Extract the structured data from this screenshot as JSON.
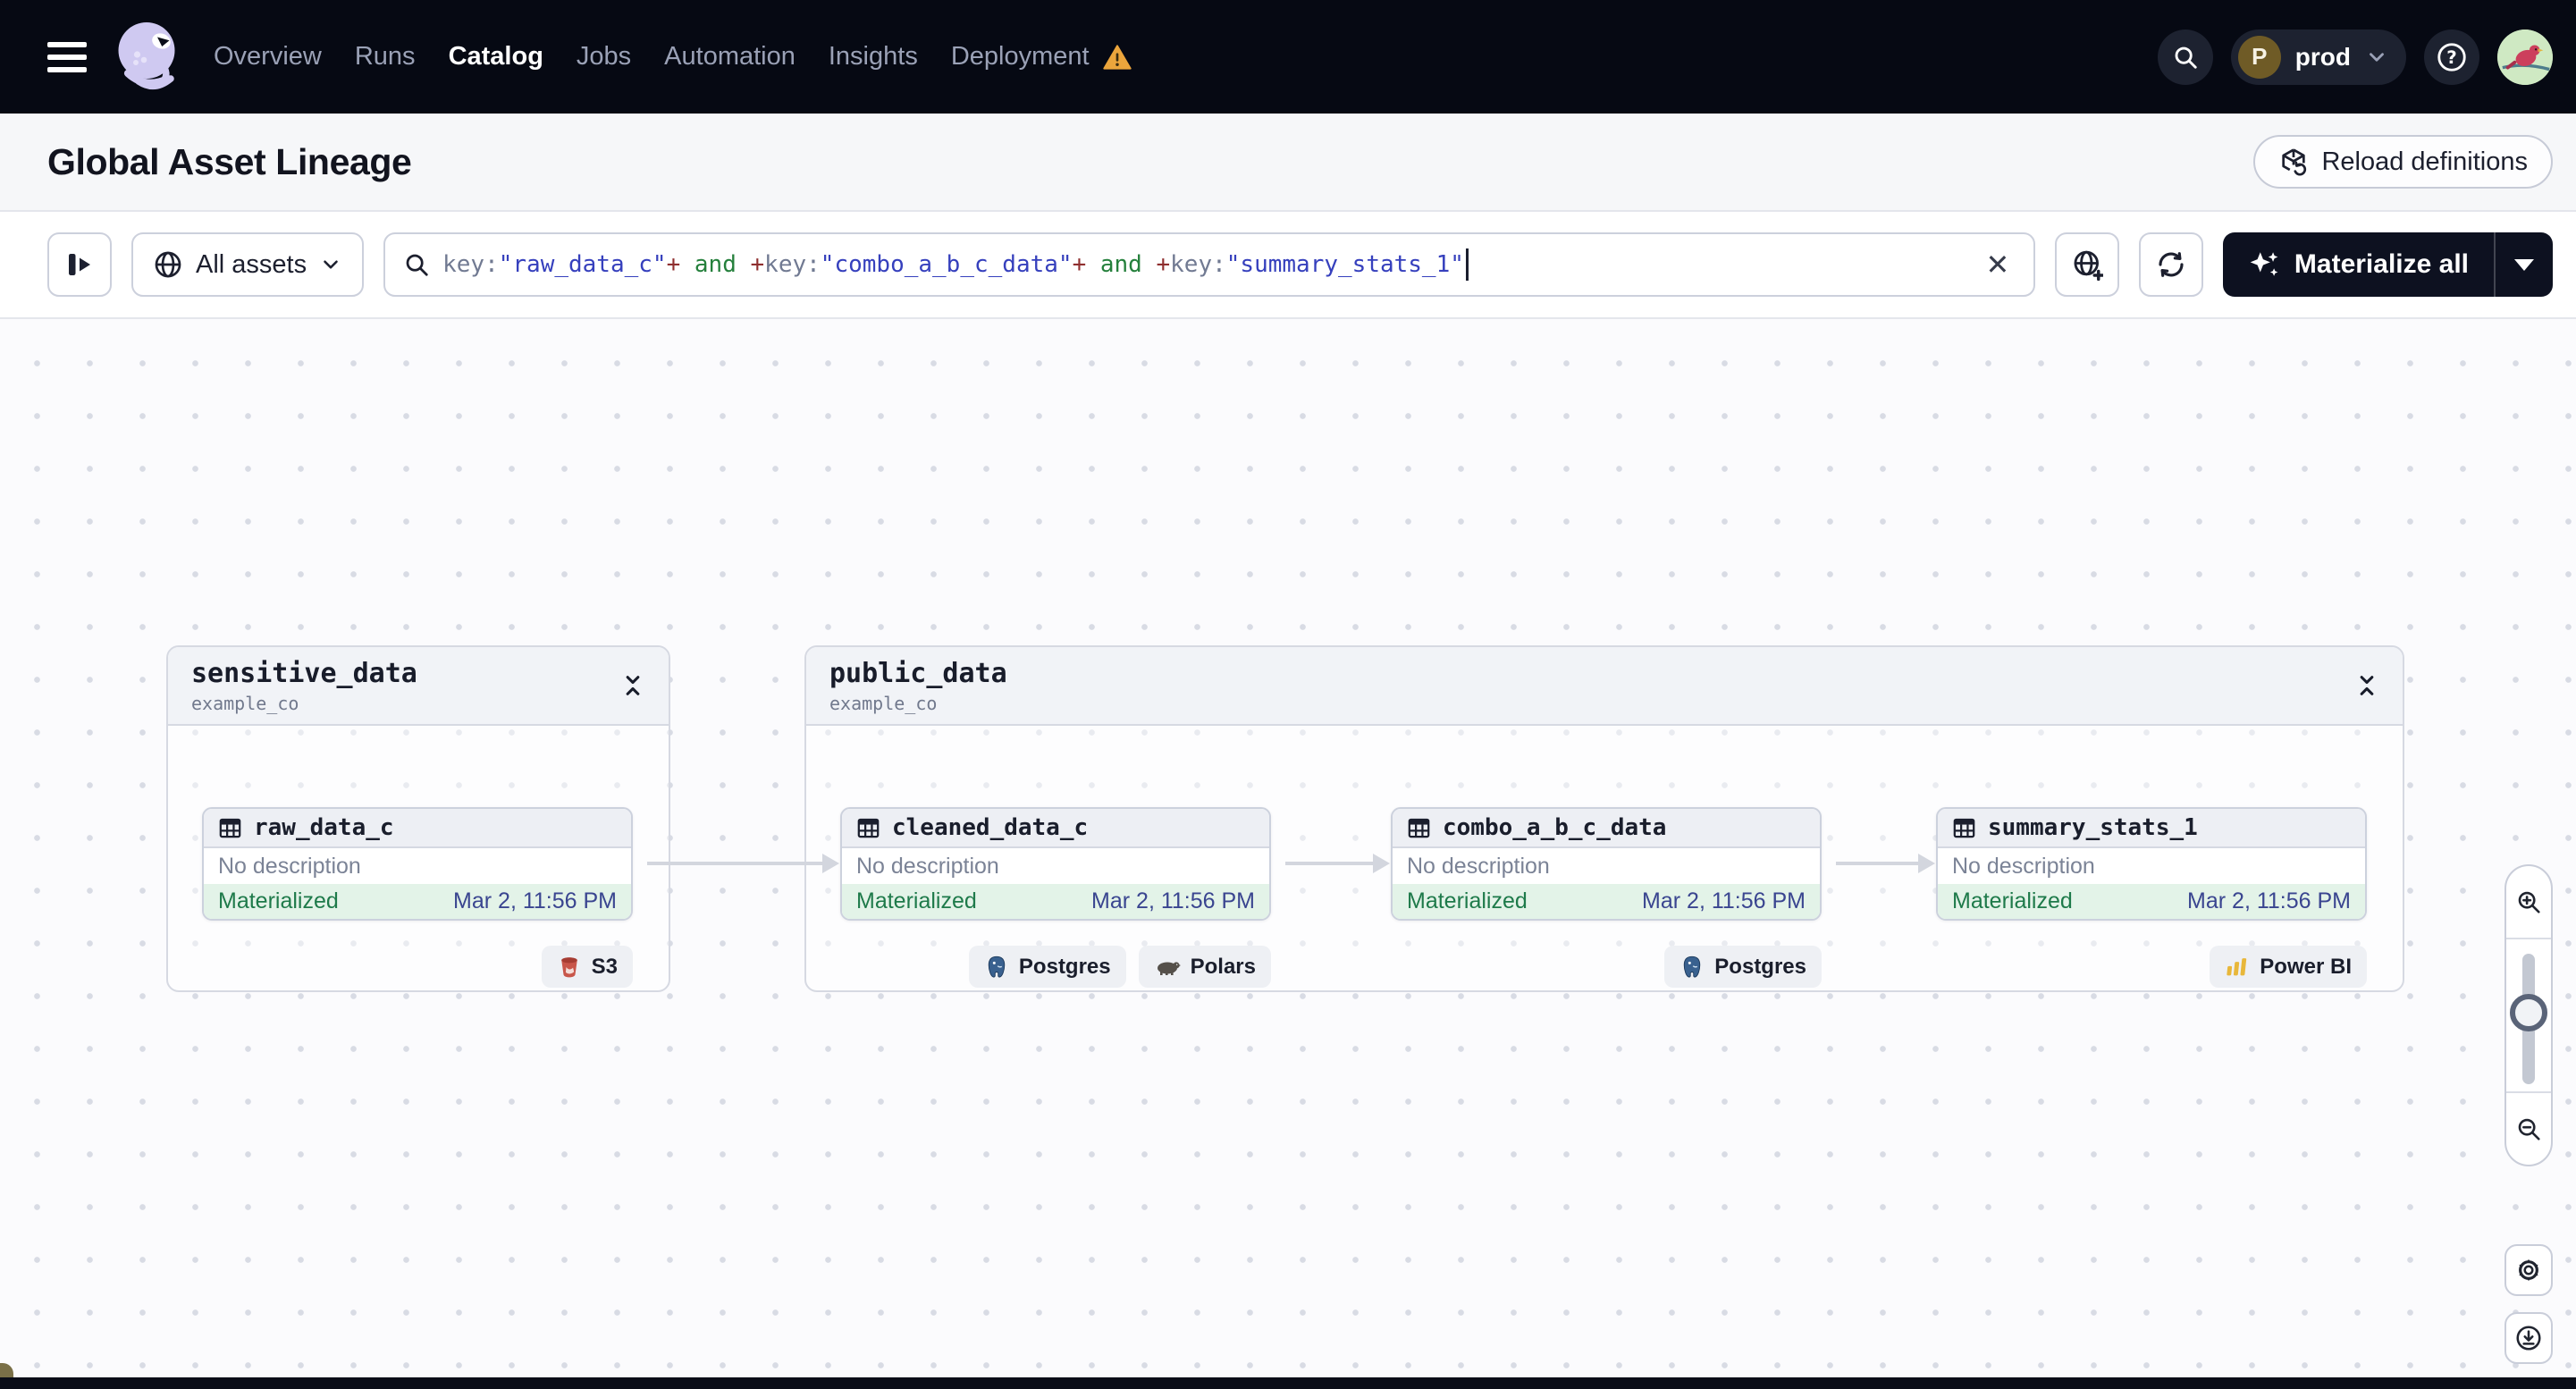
{
  "navbar": {
    "items": [
      {
        "label": "Overview",
        "active": false,
        "warning": false
      },
      {
        "label": "Runs",
        "active": false,
        "warning": false
      },
      {
        "label": "Catalog",
        "active": true,
        "warning": false
      },
      {
        "label": "Jobs",
        "active": false,
        "warning": false
      },
      {
        "label": "Automation",
        "active": false,
        "warning": false
      },
      {
        "label": "Insights",
        "active": false,
        "warning": false
      },
      {
        "label": "Deployment",
        "active": false,
        "warning": true
      }
    ],
    "workspace": {
      "initial": "P",
      "name": "prod"
    }
  },
  "page_header": {
    "title": "Global Asset Lineage",
    "reload_button": "Reload definitions"
  },
  "toolbar": {
    "scope_button": "All assets",
    "query_tokens": [
      {
        "text": "key:",
        "kind": "field"
      },
      {
        "text": "\"raw_data_c\"",
        "kind": "value"
      },
      {
        "text": "+",
        "kind": "op"
      },
      {
        "text": " and ",
        "kind": "keyword"
      },
      {
        "text": "+",
        "kind": "op"
      },
      {
        "text": "key:",
        "kind": "field"
      },
      {
        "text": "\"combo_a_b_c_data\"",
        "kind": "value"
      },
      {
        "text": "+",
        "kind": "op"
      },
      {
        "text": " and ",
        "kind": "keyword"
      },
      {
        "text": "+",
        "kind": "op"
      },
      {
        "text": "key:",
        "kind": "field"
      },
      {
        "text": "\"summary_stats_1\"",
        "kind": "value"
      }
    ],
    "materialize_button": "Materialize all"
  },
  "graph": {
    "groups": [
      {
        "name": "sensitive_data",
        "location": "example_co"
      },
      {
        "name": "public_data",
        "location": "example_co"
      }
    ],
    "nodes": [
      {
        "name": "raw_data_c",
        "description": "No description",
        "status": "Materialized",
        "materialized_at": "Mar 2, 11:56 PM",
        "tags": [
          {
            "label": "S3"
          }
        ]
      },
      {
        "name": "cleaned_data_c",
        "description": "No description",
        "status": "Materialized",
        "materialized_at": "Mar 2, 11:56 PM",
        "tags": [
          {
            "label": "Postgres"
          },
          {
            "label": "Polars"
          }
        ]
      },
      {
        "name": "combo_a_b_c_data",
        "description": "No description",
        "status": "Materialized",
        "materialized_at": "Mar 2, 11:56 PM",
        "tags": [
          {
            "label": "Postgres"
          }
        ]
      },
      {
        "name": "summary_stats_1",
        "description": "No description",
        "status": "Materialized",
        "materialized_at": "Mar 2, 11:56 PM",
        "tags": [
          {
            "label": "Power BI"
          }
        ]
      }
    ]
  },
  "colors": {
    "accent_dark": "#0d1120",
    "materialized_bg": "#e3f3e8",
    "materialized_text": "#1e7a4a",
    "timestamp_text": "#3a4590",
    "warning": "#eba53c",
    "query_value": "#3640bd",
    "query_op": "#8f2f2f",
    "query_keyword": "#25803c"
  }
}
